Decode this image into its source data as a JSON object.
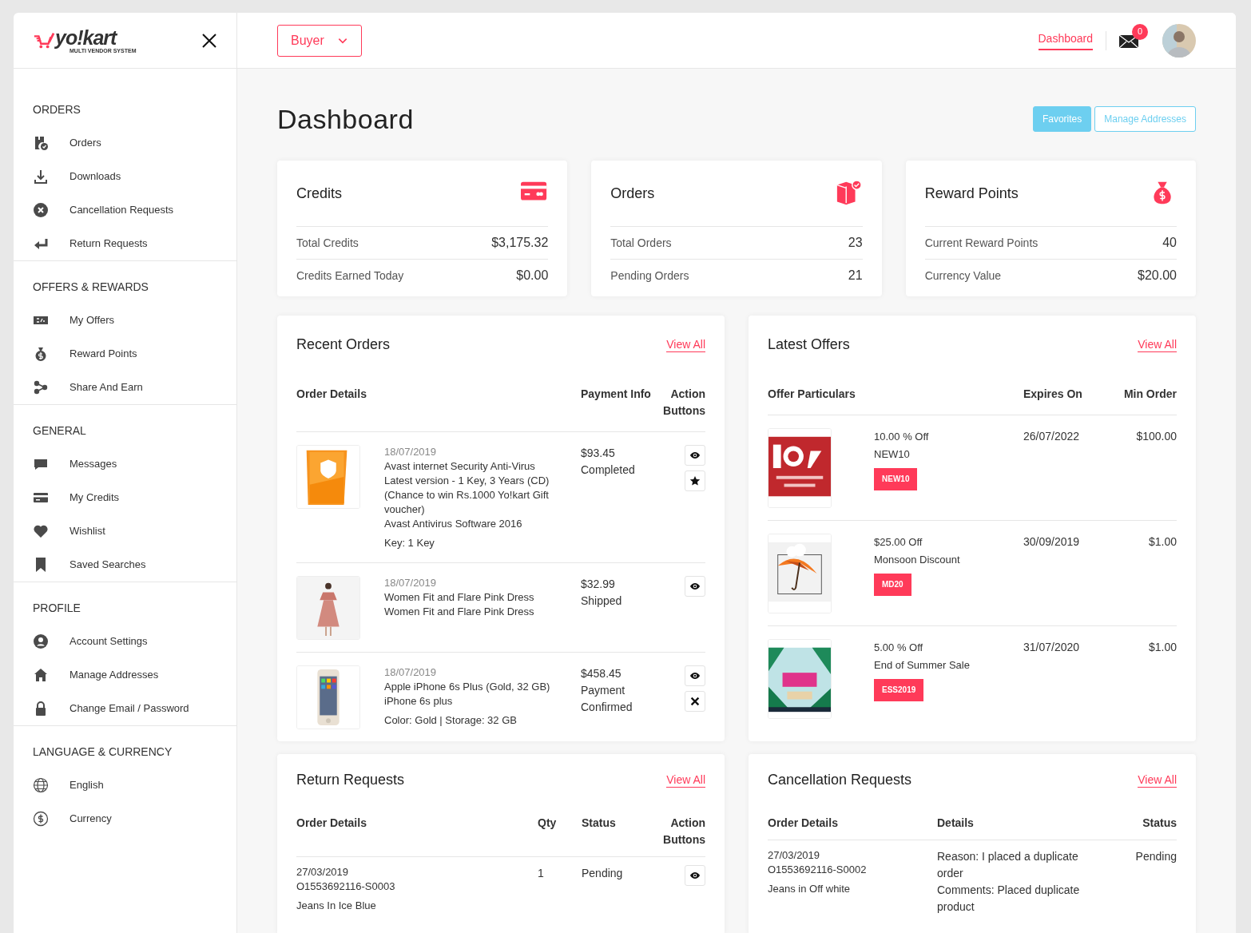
{
  "sidebar": {
    "logo": {
      "brand": "yo!kart",
      "tagline": "MULTI VENDOR SYSTEM"
    },
    "sections": [
      {
        "title": "ORDERS",
        "items": [
          {
            "label": "Orders"
          },
          {
            "label": "Downloads"
          },
          {
            "label": "Cancellation Requests"
          },
          {
            "label": "Return Requests"
          }
        ]
      },
      {
        "title": "OFFERS & REWARDS",
        "items": [
          {
            "label": "My Offers"
          },
          {
            "label": "Reward Points"
          },
          {
            "label": "Share And Earn"
          }
        ]
      },
      {
        "title": "GENERAL",
        "items": [
          {
            "label": "Messages"
          },
          {
            "label": "My Credits"
          },
          {
            "label": "Wishlist"
          },
          {
            "label": "Saved Searches"
          }
        ]
      },
      {
        "title": "PROFILE",
        "items": [
          {
            "label": "Account Settings"
          },
          {
            "label": "Manage Addresses"
          },
          {
            "label": "Change Email / Password"
          }
        ]
      },
      {
        "title": "LANGUAGE & CURRENCY",
        "items": [
          {
            "label": "English"
          },
          {
            "label": "Currency"
          }
        ]
      }
    ]
  },
  "header": {
    "role": "Buyer",
    "links": [
      {
        "label": "Dashboard",
        "selected": true
      }
    ],
    "messages_badge": "0"
  },
  "page": {
    "title": "Dashboard",
    "buttons": [
      {
        "label": "Favorites",
        "kind": "filled"
      },
      {
        "label": "Manage Addresses",
        "kind": "outline"
      }
    ]
  },
  "stat_cards": [
    {
      "title": "Credits",
      "rows": [
        {
          "label": "Total Credits",
          "value": "$3,175.32"
        },
        {
          "label": "Credits Earned Today",
          "value": "$0.00"
        }
      ]
    },
    {
      "title": "Orders",
      "rows": [
        {
          "label": "Total Orders",
          "value": "23"
        },
        {
          "label": "Pending Orders",
          "value": "21"
        }
      ]
    },
    {
      "title": "Reward Points",
      "rows": [
        {
          "label": "Current Reward Points",
          "value": "40"
        },
        {
          "label": "Currency Value",
          "value": "$20.00"
        }
      ]
    }
  ],
  "recent_orders": {
    "title": "Recent Orders",
    "view_all": "View All",
    "columns": [
      "Order Details",
      "Payment Info",
      "Action Buttons"
    ],
    "rows": [
      {
        "date": "18/07/2019",
        "lines": [
          "Avast internet Security Anti-Virus Latest version - 1 Key, 3 Years (CD) (Chance to win Rs.1000 Yo!kart Gift voucher)",
          "Avast Antivirus Software 2016"
        ],
        "meta": "Key: 1 Key",
        "amount": "$93.45",
        "status": "Completed",
        "actions": [
          {
            "kind": "view"
          },
          {
            "kind": "favorite"
          }
        ]
      },
      {
        "date": "18/07/2019",
        "lines": [
          "Women Fit and Flare Pink Dress",
          "Women Fit and Flare Pink Dress"
        ],
        "amount": "$32.99",
        "status": "Shipped",
        "actions": [
          {
            "kind": "view"
          }
        ]
      },
      {
        "date": "18/07/2019",
        "lines": [
          "Apple iPhone 6s Plus (Gold, 32 GB)",
          "iPhone 6s plus"
        ],
        "meta": "Color: Gold | Storage: 32 GB",
        "amount": "$458.45",
        "status": "Payment Confirmed",
        "actions": [
          {
            "kind": "view"
          },
          {
            "kind": "cancel"
          }
        ]
      }
    ]
  },
  "latest_offers": {
    "title": "Latest Offers",
    "view_all": "View All",
    "columns": [
      "Offer Particulars",
      "Expires On",
      "Min Order"
    ],
    "rows": [
      {
        "discount": "10.00 % Off",
        "name": "NEW10",
        "code": "NEW10",
        "expires": "26/07/2022",
        "min_order": "$100.00"
      },
      {
        "discount": "$25.00 Off",
        "name": "Monsoon Discount",
        "code": "MD20",
        "expires": "30/09/2019",
        "min_order": "$1.00"
      },
      {
        "discount": "5.00 % Off",
        "name": "End of Summer Sale",
        "code": "ESS2019",
        "expires": "31/07/2020",
        "min_order": "$1.00"
      }
    ]
  },
  "return_requests": {
    "title": "Return Requests",
    "view_all": "View All",
    "columns": [
      "Order Details",
      "Qty",
      "Status",
      "Action Buttons"
    ],
    "rows": [
      {
        "date": "27/03/2019",
        "order_id": "O1553692116-S0003",
        "product": "Jeans In Ice Blue",
        "qty": "1",
        "status": "Pending",
        "actions": [
          {
            "kind": "view"
          }
        ]
      }
    ]
  },
  "cancellation_requests": {
    "title": "Cancellation Requests",
    "view_all": "View All",
    "columns": [
      "Order Details",
      "Details",
      "Status"
    ],
    "rows": [
      {
        "date": "27/03/2019",
        "order_id": "O1553692116-S0002",
        "product": "Jeans in Off white",
        "reason": "Reason: I placed a duplicate order",
        "comments": "Comments: Placed duplicate product",
        "status": "Pending"
      }
    ]
  }
}
